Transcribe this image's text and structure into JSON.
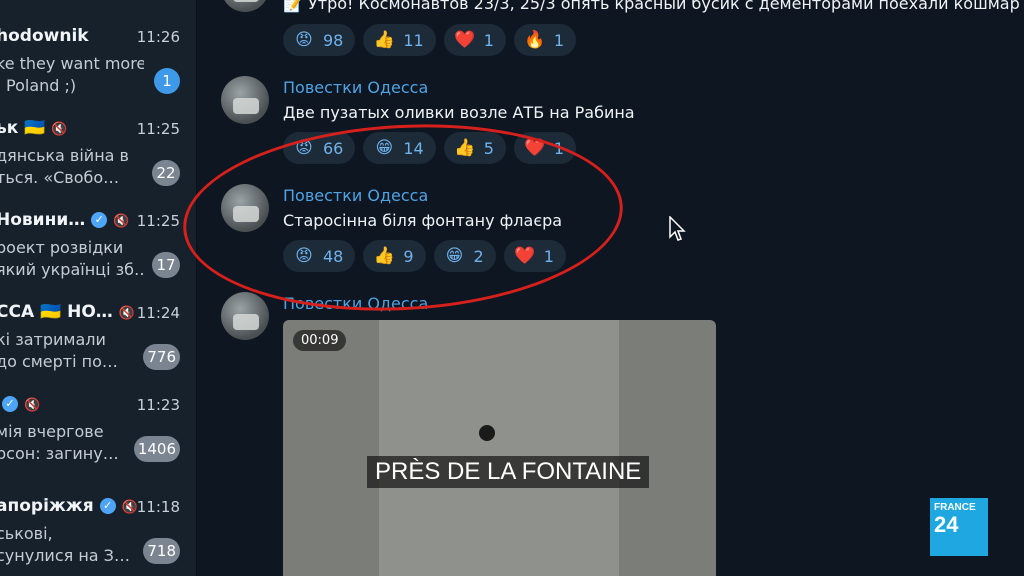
{
  "chats": [
    {
      "name": "hodownik",
      "time": "11:26",
      "line1": "ke they want more",
      "line2": "Poland ;)",
      "badge": "1",
      "badge_style": "blue",
      "verified": false,
      "muted": false
    },
    {
      "name": "ьк 🇺🇦",
      "time": "11:25",
      "line1": "дянська війна в",
      "line2": "ться.  «Свобо…",
      "badge": "22",
      "verified": false,
      "muted": true
    },
    {
      "name": "Новини…",
      "time": "11:25",
      "line1": "роект розвідки",
      "line2": "який українці зб…",
      "badge": "17",
      "verified": true,
      "muted": true
    },
    {
      "name": "ССА 🇺🇦 НО…",
      "time": "11:24",
      "line1": "кі затримали",
      "line2": "до смерті по…",
      "badge": "776",
      "verified": false,
      "muted": true
    },
    {
      "name": "",
      "time": "11:23",
      "line1": "мія вчергове",
      "line2": "рсон: загину…",
      "badge": "1406",
      "verified": true,
      "muted": true
    },
    {
      "name": "апоріжжя",
      "time": "11:18",
      "line1": "ськові,",
      "line2": "сунулися на З…",
      "badge": "718",
      "verified": true,
      "muted": true
    }
  ],
  "messages": [
    {
      "text": "📝 Утро! Космонавтов 23/3, 25/3 опять красный бусик с дементорами поехали кошмар",
      "reactions": [
        {
          "emoji": "😡",
          "count": "98"
        },
        {
          "emoji": "👍",
          "count": "11"
        },
        {
          "emoji": "❤️",
          "count": "1"
        },
        {
          "emoji": "🔥",
          "count": "1"
        }
      ]
    },
    {
      "sender": "Повестки Одесса",
      "text": "Две пузатых оливки возле АТБ на Рабина",
      "reactions": [
        {
          "emoji": "😡",
          "count": "66"
        },
        {
          "emoji": "😁",
          "count": "14"
        },
        {
          "emoji": "👍",
          "count": "5"
        },
        {
          "emoji": "❤️",
          "count": "1"
        }
      ]
    },
    {
      "sender": "Повестки Одесса",
      "text": "Старосінна біля фонтану флаєра",
      "reactions": [
        {
          "emoji": "😡",
          "count": "48"
        },
        {
          "emoji": "👍",
          "count": "9"
        },
        {
          "emoji": "😁",
          "count": "2"
        },
        {
          "emoji": "❤️",
          "count": "1"
        }
      ]
    },
    {
      "sender": "Повестки Одесса",
      "video_duration": "00:09"
    }
  ],
  "subtitle": "PRÈS DE LA FONTAINE",
  "logo": {
    "line1": "FRANCE",
    "line2": "24"
  },
  "colors": {
    "background": "#0e1621",
    "sidebar": "#17212b",
    "accent": "#4fa3e4",
    "annotation": "#d6201c"
  }
}
